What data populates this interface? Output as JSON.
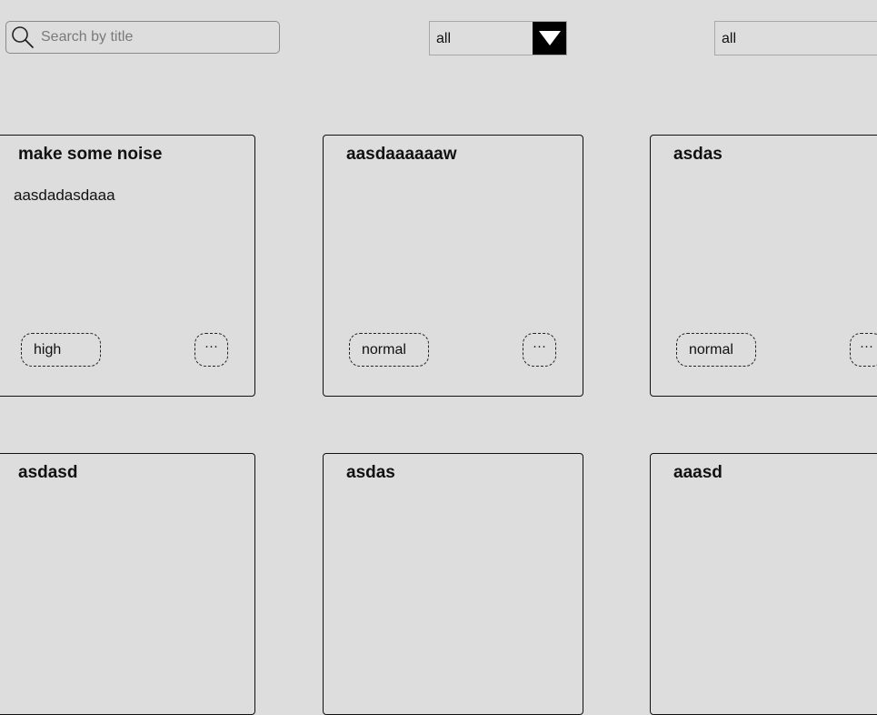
{
  "search": {
    "placeholder": "Search by title",
    "value": ""
  },
  "filters": {
    "priority": {
      "selected": "all"
    },
    "status": {
      "selected": "all"
    }
  },
  "icons": {
    "search": "magnifier-icon",
    "dropdown": "triangle-down-icon",
    "more": "ellipsis-icon"
  },
  "cards": [
    {
      "title": "make some noise",
      "description": "aasdadasdaaa",
      "priority": "high",
      "more": "···"
    },
    {
      "title": "aasdaaaaaaw",
      "description": "",
      "priority": "normal",
      "more": "···"
    },
    {
      "title": "asdas",
      "description": "",
      "priority": "normal",
      "more": "···"
    },
    {
      "title": "asdasd",
      "description": "",
      "priority": "",
      "more": ""
    },
    {
      "title": "asdas",
      "description": "",
      "priority": "",
      "more": ""
    },
    {
      "title": "aaasd",
      "description": "",
      "priority": "",
      "more": ""
    }
  ]
}
